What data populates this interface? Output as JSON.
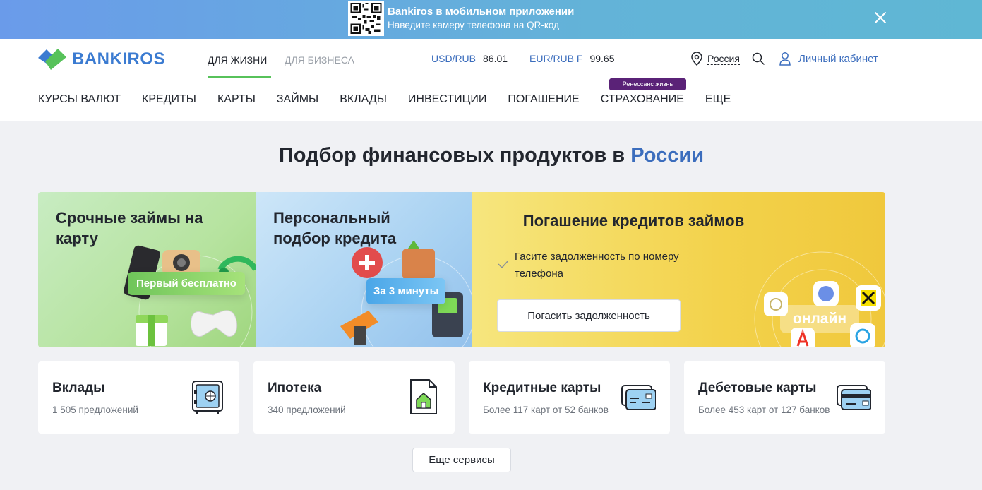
{
  "promo_banner": {
    "title": "Bankiros в мобильном приложении",
    "subtitle": "Наведите камеру телефона на QR-код"
  },
  "header": {
    "logo_text": "BANKIROS",
    "segments": [
      "Для жизни",
      "Для бизнеса"
    ],
    "rates": [
      {
        "pair": "USD/RUB",
        "value": "86.01"
      },
      {
        "pair": "EUR/RUB F",
        "value": "99.65"
      }
    ],
    "region": "Россия",
    "cabinet": "Личный кабинет",
    "partner_badge": "Ренессанс жизнь"
  },
  "nav": [
    "Курсы валют",
    "Кредиты",
    "Карты",
    "Займы",
    "Вклады",
    "Инвестиции",
    "Погашение",
    "Страхование",
    "Еще"
  ],
  "main": {
    "title_prefix": "Подбор финансовых продуктов в",
    "title_region": "России"
  },
  "promos": {
    "card_a": {
      "title": "Срочные займы на карту",
      "pill": "Первый бесплатно"
    },
    "card_b": {
      "title": "Персональный подбор кредита",
      "pill": "За 3 минуты"
    },
    "card_c": {
      "title": "Погашение кредитов займов",
      "text": "Гасите задолженность по номеру телефона",
      "button": "Погасить задолженность",
      "badge": "онлайн"
    }
  },
  "tiles": [
    {
      "name": "Вклады",
      "sub": "1 505 предложений",
      "icon": "safe-icon"
    },
    {
      "name": "Ипотека",
      "sub": "340 предложений",
      "icon": "house-document-icon"
    },
    {
      "name": "Кредитные карты",
      "sub": "Более 117 карт от 52 банков",
      "icon": "credit-card-icon"
    },
    {
      "name": "Дебетовые карты",
      "sub": "Более 453 карт от 127 банков",
      "icon": "debit-card-icon"
    }
  ],
  "more_button": "Еще сервисы",
  "colors": {
    "brand_blue": "#3b7bd1",
    "brand_green": "#57c25a",
    "link": "#3b6dbd"
  }
}
